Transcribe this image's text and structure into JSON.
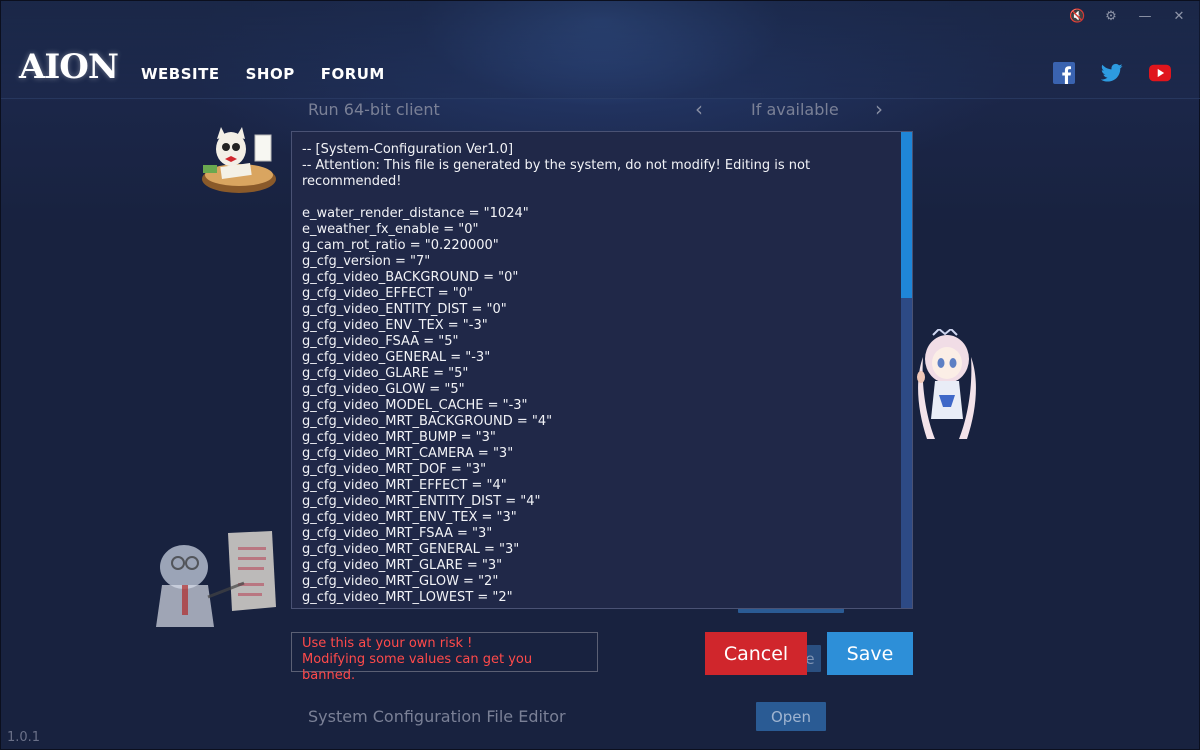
{
  "window": {
    "controls": [
      {
        "icon": "mute-icon",
        "glyph": "🔇"
      },
      {
        "icon": "gear-icon",
        "glyph": "⚙"
      },
      {
        "icon": "minimize-icon",
        "glyph": "—"
      },
      {
        "icon": "close-icon",
        "glyph": "✕"
      }
    ]
  },
  "header": {
    "logo": "AION",
    "nav": [
      "WEBSITE",
      "SHOP",
      "FORUM"
    ],
    "social": [
      "facebook-icon",
      "twitter-icon",
      "youtube-icon"
    ]
  },
  "background_settings": {
    "run_64bit_label": "Run 64-bit client",
    "run_64bit_value": "If available",
    "sysconfig_label": "System Configuration File Editor",
    "open_label": "Open",
    "partial_button_label": "e"
  },
  "editor": {
    "lines": [
      "-- [System-Configuration Ver1.0]",
      "-- Attention: This file is generated by the system, do not modify! Editing is not recommended!",
      "",
      "e_water_render_distance = \"1024\"",
      "e_weather_fx_enable = \"0\"",
      "g_cam_rot_ratio = \"0.220000\"",
      "g_cfg_version = \"7\"",
      "g_cfg_video_BACKGROUND = \"0\"",
      "g_cfg_video_EFFECT = \"0\"",
      "g_cfg_video_ENTITY_DIST = \"0\"",
      "g_cfg_video_ENV_TEX = \"-3\"",
      "g_cfg_video_FSAA = \"5\"",
      "g_cfg_video_GENERAL = \"-3\"",
      "g_cfg_video_GLARE = \"5\"",
      "g_cfg_video_GLOW = \"5\"",
      "g_cfg_video_MODEL_CACHE = \"-3\"",
      "g_cfg_video_MRT_BACKGROUND = \"4\"",
      "g_cfg_video_MRT_BUMP = \"3\"",
      "g_cfg_video_MRT_CAMERA = \"3\"",
      "g_cfg_video_MRT_DOF = \"3\"",
      "g_cfg_video_MRT_EFFECT = \"4\"",
      "g_cfg_video_MRT_ENTITY_DIST = \"4\"",
      "g_cfg_video_MRT_ENV_TEX = \"3\"",
      "g_cfg_video_MRT_FSAA = \"3\"",
      "g_cfg_video_MRT_GENERAL = \"3\"",
      "g_cfg_video_MRT_GLARE = \"3\"",
      "g_cfg_video_MRT_GLOW = \"2\"",
      "g_cfg_video_MRT_LOWEST = \"2\""
    ]
  },
  "warning": {
    "line1": "Use this at your own risk !",
    "line2": "Modifying some values can get you banned."
  },
  "buttons": {
    "cancel": "Cancel",
    "save": "Save"
  },
  "version": "1.0.1",
  "colors": {
    "cancel": "#d0262c",
    "save": "#2d8fd8",
    "warning_text": "#ff4a4a",
    "scroll_thumb": "#1f86d8"
  }
}
